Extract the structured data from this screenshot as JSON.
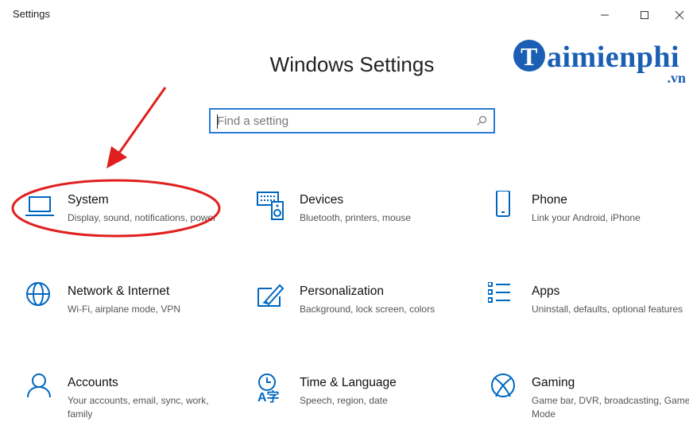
{
  "window": {
    "title": "Settings",
    "controls": [
      "minimize-icon",
      "maximize-icon",
      "close-icon"
    ]
  },
  "heading": "Windows Settings",
  "logo": {
    "initial": "T",
    "brand": "aimienphi",
    "tld": ".vn",
    "color": "#1a5fb4"
  },
  "search": {
    "placeholder": "Find a setting",
    "value": "",
    "icon": "search-icon"
  },
  "accent": "#0067c0",
  "annotation": {
    "color": "#e02020",
    "target": "System"
  },
  "categories": [
    {
      "title": "System",
      "desc": "Display, sound, notifications, power",
      "icon": "laptop-icon"
    },
    {
      "title": "Devices",
      "desc": "Bluetooth, printers, mouse",
      "icon": "keyboard-speaker-icon"
    },
    {
      "title": "Phone",
      "desc": "Link your Android, iPhone",
      "icon": "phone-icon"
    },
    {
      "title": "Network & Internet",
      "desc": "Wi-Fi, airplane mode, VPN",
      "icon": "globe-icon"
    },
    {
      "title": "Personalization",
      "desc": "Background, lock screen, colors",
      "icon": "paint-icon"
    },
    {
      "title": "Apps",
      "desc": "Uninstall, defaults, optional features",
      "icon": "apps-list-icon"
    },
    {
      "title": "Accounts",
      "desc": "Your accounts, email, sync, work, family",
      "icon": "person-icon"
    },
    {
      "title": "Time & Language",
      "desc": "Speech, region, date",
      "icon": "time-language-icon"
    },
    {
      "title": "Gaming",
      "desc": "Game bar, DVR, broadcasting, Game Mode",
      "icon": "xbox-icon"
    }
  ]
}
